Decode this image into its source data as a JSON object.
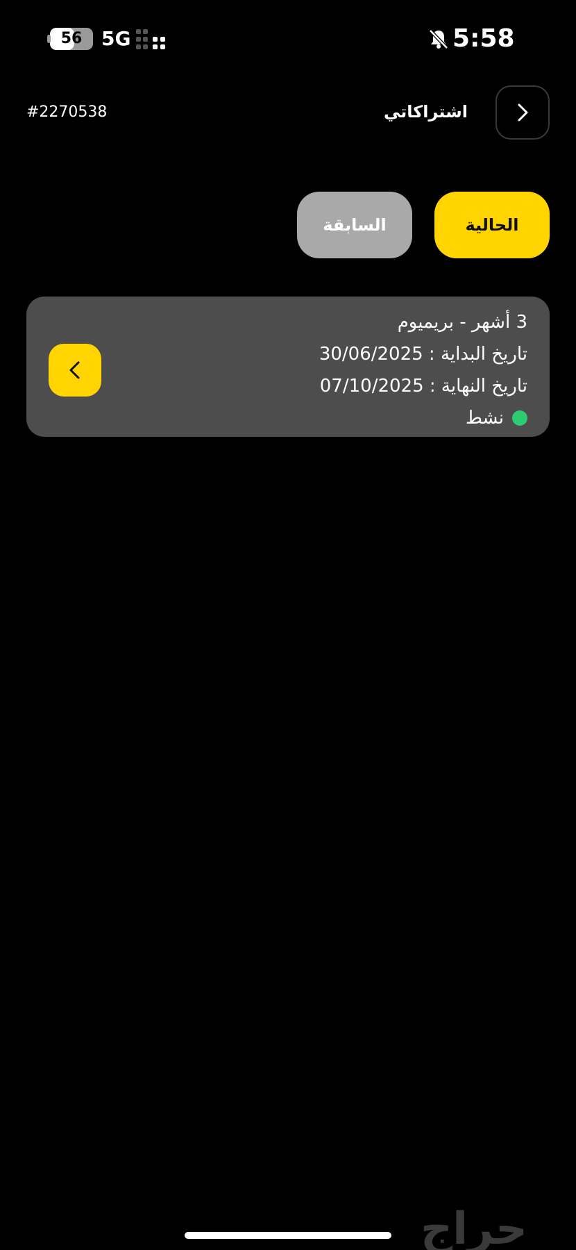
{
  "status_bar": {
    "battery_level": "56",
    "battery_fraction": 0.56,
    "network": "5G",
    "time": "5:58",
    "icons": [
      "battery-icon",
      "signal-icon",
      "bell-off-icon"
    ]
  },
  "header": {
    "order_id": "#2270538",
    "title": "اشتراكاتي",
    "back_icon": "chevron-right-icon"
  },
  "tabs": [
    {
      "label": "الحالية",
      "active": true
    },
    {
      "label": "السابقة",
      "active": false
    }
  ],
  "subscription": {
    "plan": "3 أشهر - بريميوم",
    "start_date": "تاريخ البداية : 30/06/2025",
    "end_date": "تاريخ النهاية : 07/10/2025",
    "status": "نشط",
    "status_color": "#2ECC71",
    "detail_icon": "chevron-left-icon"
  },
  "watermark": "حراج",
  "colors": {
    "accent": "#FFD400",
    "card": "#4D4D4D",
    "inactive_tab": "#A9A9A9",
    "background": "#000000"
  }
}
